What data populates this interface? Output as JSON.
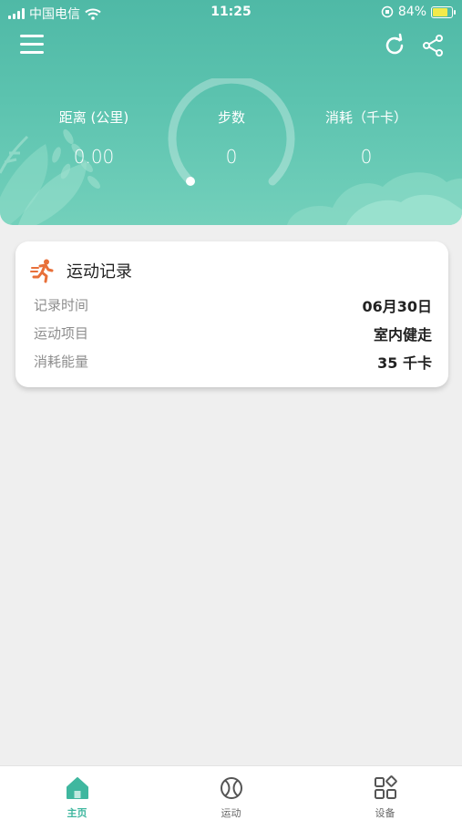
{
  "status_bar": {
    "carrier": "中国电信",
    "time": "11:25",
    "battery": "84%",
    "battery_level": 0.84
  },
  "header": {
    "icons": [
      "menu-icon",
      "refresh-icon",
      "share-icon"
    ],
    "stats": {
      "distance": {
        "label": "距离 (公里)",
        "value": "0.00"
      },
      "steps": {
        "label": "步数",
        "value": "0"
      },
      "calories": {
        "label": "消耗（千卡）",
        "value": "0"
      }
    },
    "colors": {
      "gradient_top": "#4fb9a6",
      "gradient_bottom": "#73d0bb"
    }
  },
  "record": {
    "title": "运动记录",
    "icon": "runner-icon",
    "accent": "#e8703a",
    "rows": [
      {
        "key": "记录时间",
        "value": "06月30日"
      },
      {
        "key": "运动项目",
        "value": "室内健走"
      },
      {
        "key": "消耗能量",
        "value": "35 千卡"
      }
    ]
  },
  "tabbar": {
    "accent": "#3fb79f",
    "items": [
      {
        "label": "主页",
        "icon": "home-icon",
        "active": true
      },
      {
        "label": "运动",
        "icon": "ball-icon",
        "active": false
      },
      {
        "label": "设备",
        "icon": "grid-icon",
        "active": false
      }
    ]
  }
}
